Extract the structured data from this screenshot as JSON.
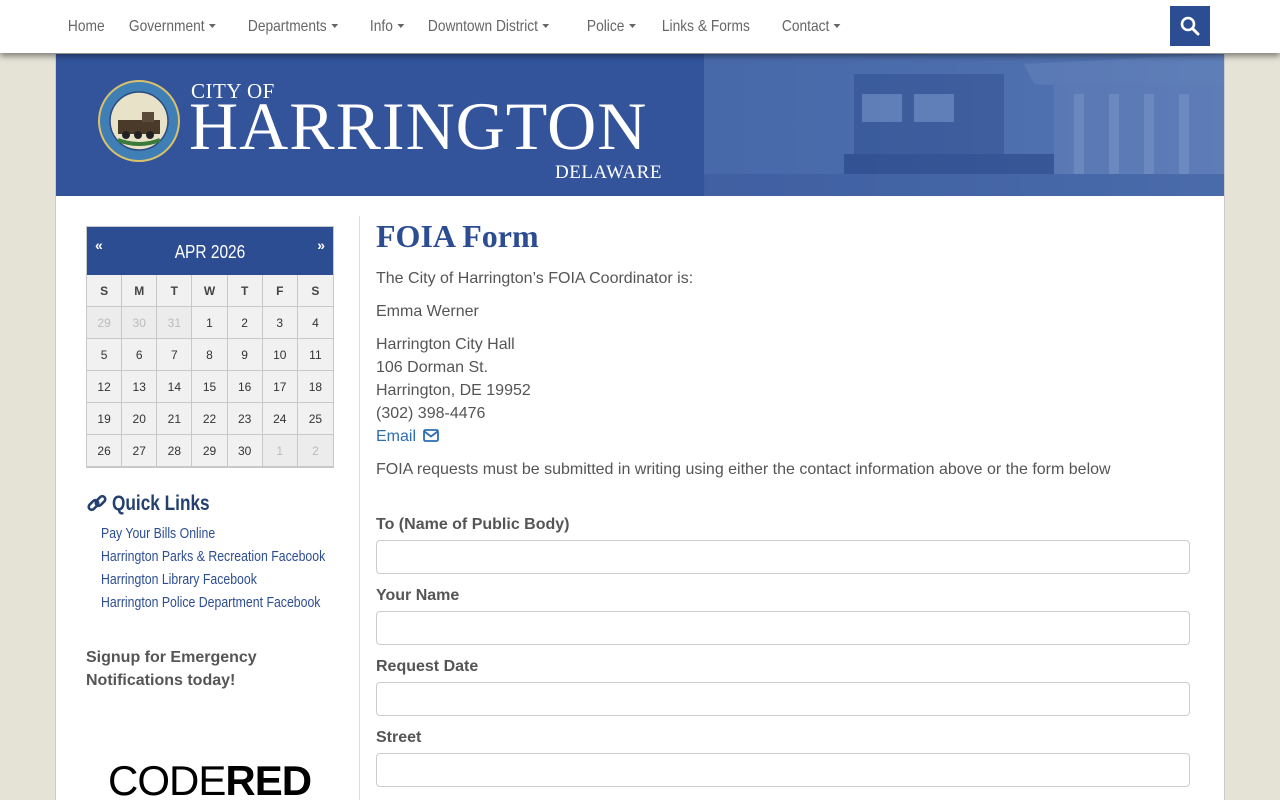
{
  "nav": {
    "items": [
      {
        "label": "Home",
        "dropdown": false
      },
      {
        "label": "Government",
        "dropdown": true
      },
      {
        "label": "Departments",
        "dropdown": true
      },
      {
        "label": "Info",
        "dropdown": true
      },
      {
        "label": "Downtown District",
        "dropdown": true
      },
      {
        "label": "Police",
        "dropdown": true
      },
      {
        "label": "Links & Forms",
        "dropdown": false
      },
      {
        "label": "Contact",
        "dropdown": true
      }
    ],
    "search_icon": "search-icon"
  },
  "banner": {
    "city_of": "CITY OF",
    "city_name": "HARRINGTON",
    "state": "DELAWARE",
    "seal_text_top": "CITY OF HARRINGTON",
    "seal_text_bottom": "DELAWARE"
  },
  "calendar": {
    "prev": "«",
    "next": "»",
    "title": "APR 2026",
    "days_of_week": [
      "S",
      "M",
      "T",
      "W",
      "T",
      "F",
      "S"
    ],
    "weeks": [
      [
        {
          "d": "29",
          "m": true
        },
        {
          "d": "30",
          "m": true
        },
        {
          "d": "31",
          "m": true
        },
        {
          "d": "1"
        },
        {
          "d": "2"
        },
        {
          "d": "3"
        },
        {
          "d": "4"
        }
      ],
      [
        {
          "d": "5"
        },
        {
          "d": "6"
        },
        {
          "d": "7"
        },
        {
          "d": "8"
        },
        {
          "d": "9"
        },
        {
          "d": "10"
        },
        {
          "d": "11"
        }
      ],
      [
        {
          "d": "12"
        },
        {
          "d": "13"
        },
        {
          "d": "14"
        },
        {
          "d": "15"
        },
        {
          "d": "16"
        },
        {
          "d": "17"
        },
        {
          "d": "18"
        }
      ],
      [
        {
          "d": "19"
        },
        {
          "d": "20"
        },
        {
          "d": "21"
        },
        {
          "d": "22"
        },
        {
          "d": "23"
        },
        {
          "d": "24"
        },
        {
          "d": "25"
        }
      ],
      [
        {
          "d": "26"
        },
        {
          "d": "27"
        },
        {
          "d": "28"
        },
        {
          "d": "29"
        },
        {
          "d": "30"
        },
        {
          "d": "1",
          "m": true
        },
        {
          "d": "2",
          "m": true
        }
      ]
    ]
  },
  "quick_links": {
    "title": "Quick Links",
    "items": [
      "Pay Your Bills Online",
      "Harrington Parks & Recreation Facebook",
      "Harrington Library Facebook",
      "Harrington Police Department Facebook"
    ]
  },
  "signup": {
    "line1": "Signup for Emergency",
    "line2": "Notifications today!"
  },
  "codered": {
    "part1": "CODE",
    "part2": "RED"
  },
  "main": {
    "title": "FOIA Form",
    "coordinator_intro": "The City of Harrington’s FOIA Coordinator is:",
    "coordinator_name": "Emma Werner",
    "address_line1": "Harrington City Hall",
    "address_line2": "106 Dorman St.",
    "address_line3": "Harrington, DE 19952",
    "phone": "(302) 398-4476",
    "email_label": "Email",
    "instructions": "FOIA requests must be submitted in writing using either the contact information above or the form below"
  },
  "form": {
    "fields": [
      {
        "label": "To (Name of Public Body)",
        "value": ""
      },
      {
        "label": "Your Name",
        "value": ""
      },
      {
        "label": "Request Date",
        "value": ""
      },
      {
        "label": "Street",
        "value": ""
      }
    ]
  },
  "colors": {
    "brand": "#2d4d93",
    "link": "#2d6db3",
    "background": "#e5e2d6"
  }
}
